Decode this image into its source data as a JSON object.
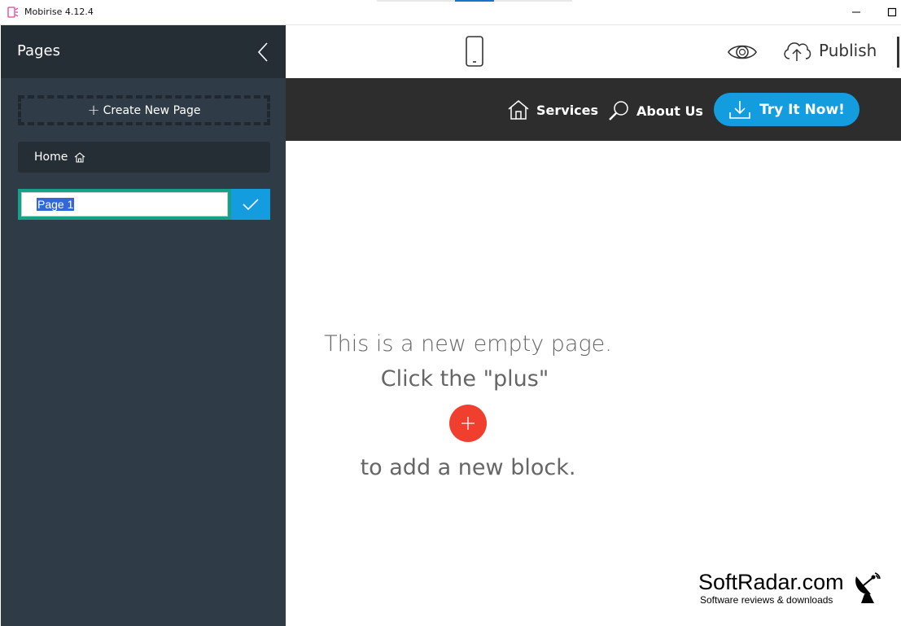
{
  "window": {
    "title": "Mobirise 4.12.4"
  },
  "sidebar": {
    "title": "Pages",
    "create_label": "Create New Page",
    "pages": [
      {
        "label": "Home"
      }
    ],
    "rename_value": "Page 1"
  },
  "navbar": {
    "links": [
      {
        "label": "Services"
      },
      {
        "label": "About Us"
      }
    ],
    "cta_label": "Try It Now!"
  },
  "toolbar": {
    "publish_label": "Publish"
  },
  "empty_page": {
    "line1": "This is a new empty page.",
    "line2": "Click the \"plus\"",
    "line3": "to add a new block."
  },
  "watermark": {
    "title": "SoftRadar.com",
    "subtitle": "Software reviews & downloads"
  },
  "colors": {
    "sidebar_bg": "#2f3b47",
    "sidebar_header": "#252d35",
    "accent_blue": "#149dde",
    "accent_teal": "#14a389",
    "plus_red": "#f03e2f",
    "navbar_bg": "#2d2d2d"
  }
}
